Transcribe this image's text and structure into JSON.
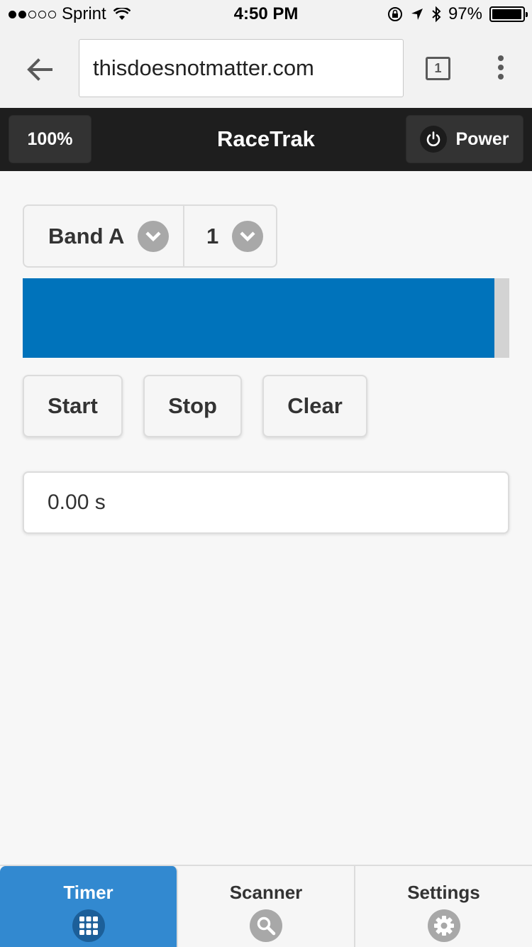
{
  "status_bar": {
    "carrier": "Sprint",
    "time": "4:50 PM",
    "battery_pct": "97%",
    "battery_level": 0.97,
    "signal_bars_filled": 2,
    "signal_bars_total": 5
  },
  "browser": {
    "url": "thisdoesnotmatter.com",
    "tab_count": "1"
  },
  "header": {
    "title": "RaceTrak",
    "level_button": "100%",
    "power_button": "Power"
  },
  "selectors": {
    "band": "Band A",
    "channel": "1"
  },
  "signal_meter": {
    "level": 0.97,
    "fill_color": "#0073bb",
    "track_color": "#d3d3d3"
  },
  "actions": {
    "start": "Start",
    "stop": "Stop",
    "clear": "Clear"
  },
  "timer_display": {
    "value": "0.00 s"
  },
  "nav": {
    "items": [
      {
        "label": "Timer",
        "icon": "grid-icon",
        "active": true
      },
      {
        "label": "Scanner",
        "icon": "search-icon",
        "active": false
      },
      {
        "label": "Settings",
        "icon": "gear-icon",
        "active": false
      }
    ],
    "active_color": "#3289d0"
  }
}
